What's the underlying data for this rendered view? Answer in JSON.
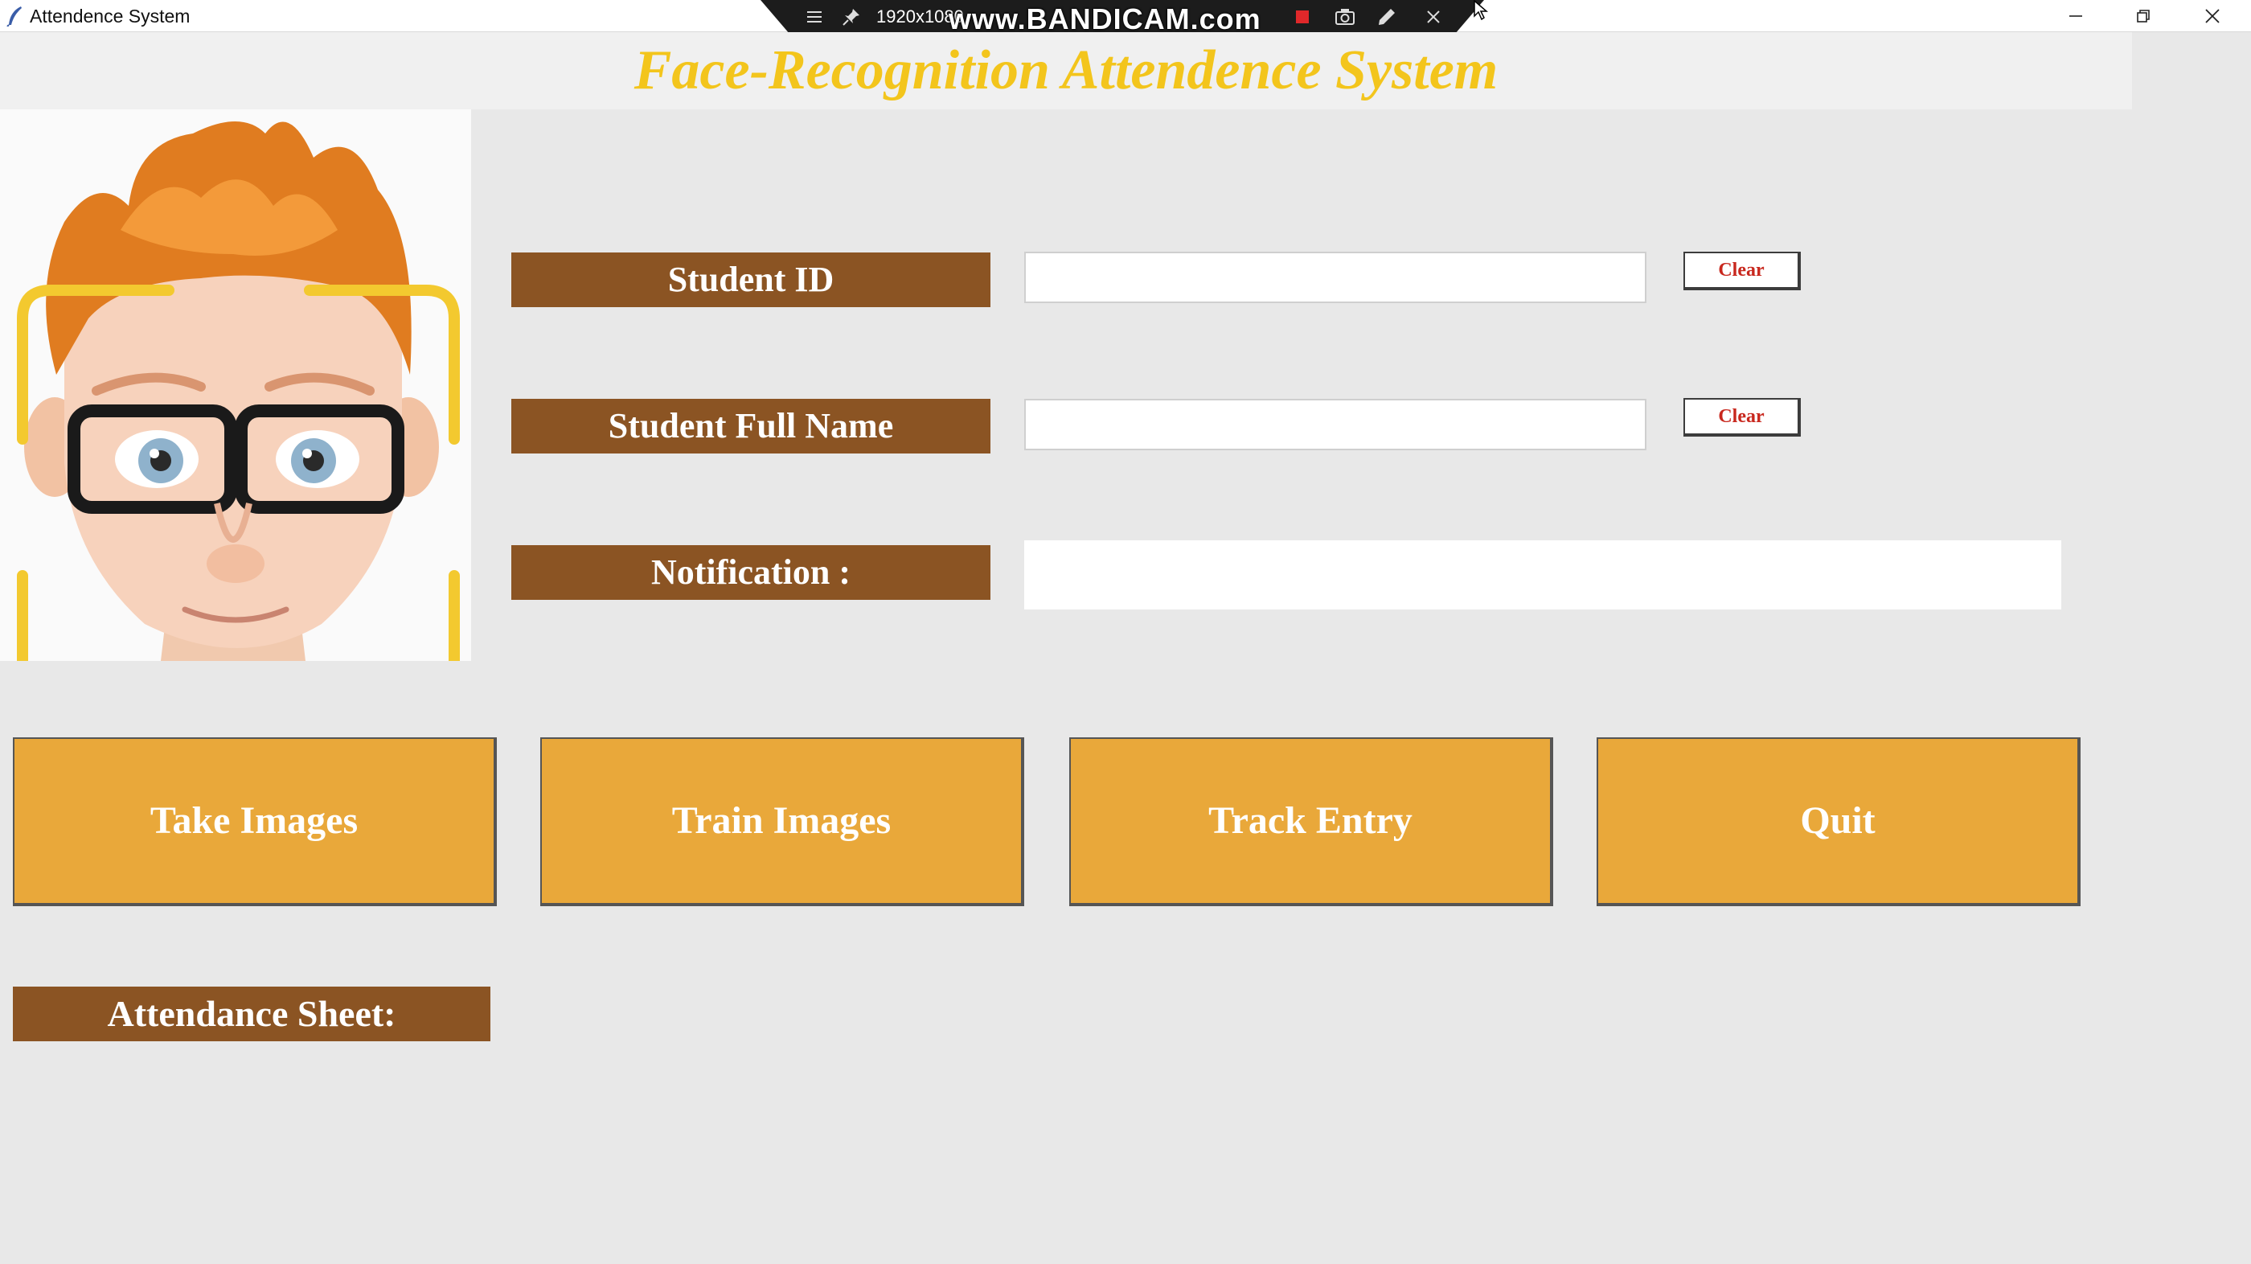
{
  "window": {
    "title": "Attendence System",
    "controls": [
      "minimize",
      "restore",
      "close"
    ]
  },
  "recorder": {
    "resolution": "1920x1080",
    "watermark": "www.BANDICAM.com",
    "icons": [
      "menu-icon",
      "pin-icon",
      "record-icon",
      "camera-icon",
      "pencil-icon",
      "close-icon"
    ]
  },
  "header": {
    "title": "Face-Recognition Attendence System"
  },
  "form": {
    "student_id": {
      "label": "Student ID",
      "value": "",
      "clear_label": "Clear"
    },
    "student_name": {
      "label": "Student Full Name",
      "value": "",
      "clear_label": "Clear"
    },
    "notification": {
      "label": "Notification :",
      "value": ""
    }
  },
  "actions": {
    "take_images": "Take Images",
    "train_images": "Train Images",
    "track_entry": "Track Entry",
    "quit": "Quit"
  },
  "attendance": {
    "label": "Attendance Sheet:"
  },
  "colors": {
    "title_yellow": "#f3c51c",
    "label_brown": "#8b5423",
    "button_orange": "#e9a83a",
    "clear_red": "#c8281e",
    "background": "#e8e8e8"
  }
}
